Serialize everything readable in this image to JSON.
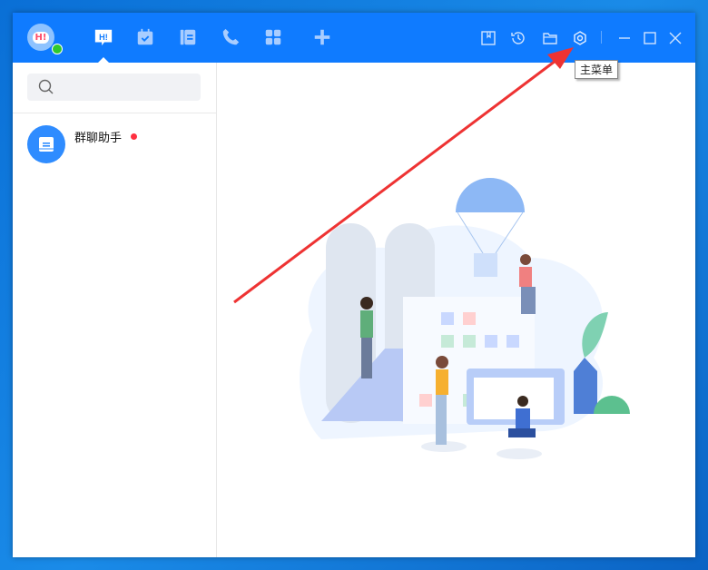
{
  "header": {
    "avatar_text": "H!",
    "nav_items": [
      "chat",
      "calendar",
      "docs",
      "phone",
      "apps",
      "add"
    ],
    "toolbar_icons": [
      "bookmark",
      "history",
      "folder",
      "settings"
    ],
    "window_controls": [
      "minimize",
      "maximize",
      "close"
    ]
  },
  "tooltip": "主菜单",
  "search": {
    "placeholder": ""
  },
  "conversations": [
    {
      "name": "群聊助手",
      "unread": true
    }
  ],
  "colors": {
    "header": "#0f7bff",
    "accent": "#2f8cff",
    "unread": "#ff3040",
    "arrow": "#ee3333"
  }
}
